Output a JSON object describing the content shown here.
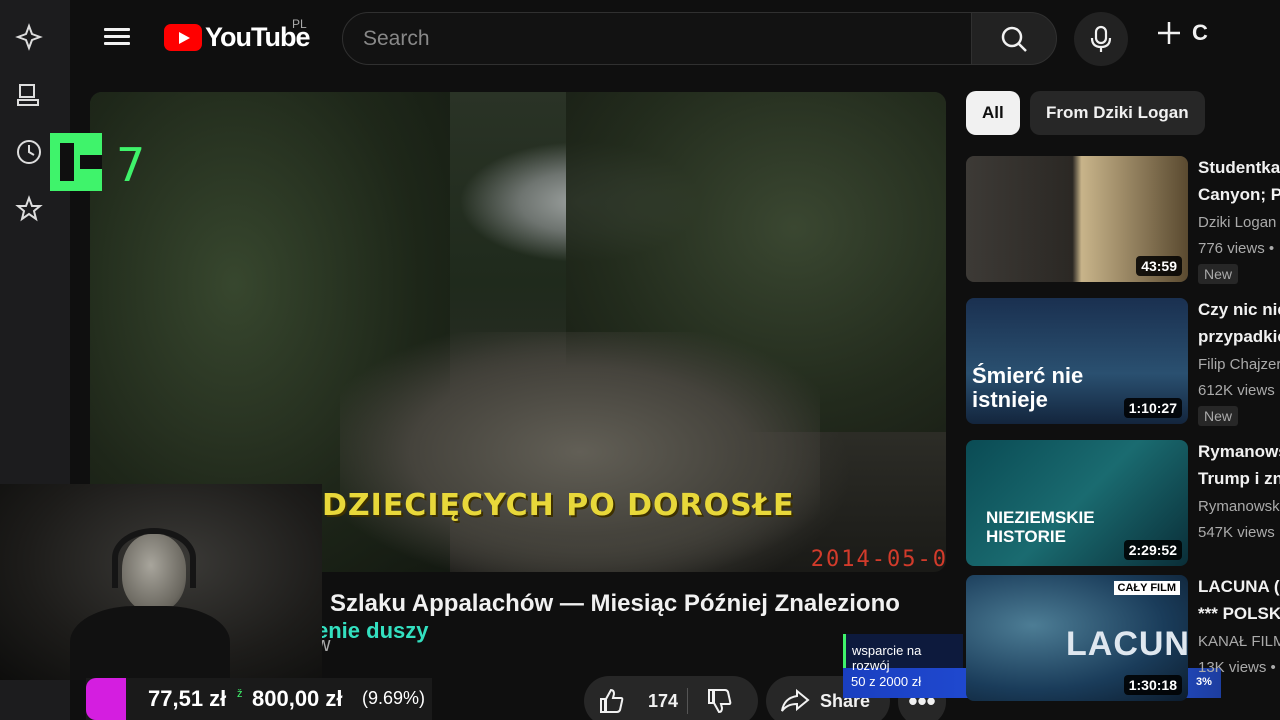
{
  "header": {
    "logo_text": "YouTube",
    "region": "PL",
    "search_placeholder": "Search",
    "create_label": "C"
  },
  "overlay": {
    "k_counter": "7"
  },
  "video": {
    "caption": "DZIECIĘCYCH PO DOROSŁE",
    "date_stamp": "2014-05-0",
    "title": "Szlaku Appalachów — Miesiąc Później Znaleziono",
    "overlay_line": "enie duszy",
    "overlay_line2": "w"
  },
  "donation": {
    "amount1": "77,51 zł",
    "amount2": "800,00 zł",
    "percent": "(9.69%)"
  },
  "actions": {
    "likes": "174",
    "share_label": "Share",
    "more_label": "•••"
  },
  "support": {
    "label": "wsparcie na rozwój",
    "count": "50 z 2000 zł",
    "percent": "3%",
    "progress_fraction": 0.03
  },
  "chips": [
    "All",
    "From Dziki Logan"
  ],
  "recommendations": [
    {
      "title1": "Studentka",
      "title2": "Canyon; P",
      "channel": "Dziki Logan",
      "views": "776 views •",
      "badge": "New",
      "duration": "43:59",
      "thumb_text": ""
    },
    {
      "title1": "Czy nic nie",
      "title2": "przypadkie",
      "channel": "Filip Chajzer",
      "views": "612K views",
      "badge": "New",
      "duration": "1:10:27",
      "thumb_text": "Śmierć nie istnieje"
    },
    {
      "title1": "Rymanows",
      "title2": "Trump i zn",
      "channel": "Rymanowsk",
      "views": "547K views",
      "badge": "",
      "duration": "2:29:52",
      "thumb_text": "NIEZIEMSKIE HISTORIE"
    },
    {
      "title1": "LACUNA (",
      "title2": "*** POLSK",
      "channel": "KANAŁ FILM",
      "views": "13K views •",
      "badge": "",
      "duration": "1:30:18",
      "thumb_text": "LACUNA",
      "thumb_badge": "CAŁY FILM"
    }
  ]
}
